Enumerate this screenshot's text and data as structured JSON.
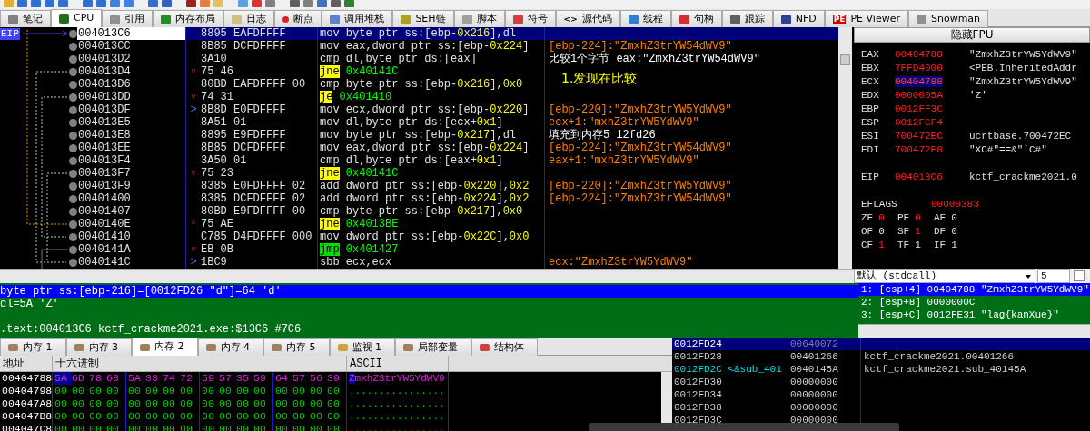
{
  "tabs": [
    {
      "label": "笔记",
      "selected": false
    },
    {
      "label": "CPU",
      "selected": true
    },
    {
      "label": "引用",
      "selected": false
    },
    {
      "label": "内存布局",
      "selected": false
    },
    {
      "label": "日志",
      "selected": false
    },
    {
      "label": "断点",
      "selected": false
    },
    {
      "label": "调用堆栈",
      "selected": false
    },
    {
      "label": "SEH链",
      "selected": false
    },
    {
      "label": "脚本",
      "selected": false
    },
    {
      "label": "符号",
      "selected": false
    },
    {
      "label": "源代码",
      "selected": false,
      "icon_text": "<>"
    },
    {
      "label": "线程",
      "selected": false
    },
    {
      "label": "句柄",
      "selected": false
    },
    {
      "label": "跟踪",
      "selected": false
    },
    {
      "label": "NFD",
      "selected": false
    },
    {
      "label": "PE Viewer",
      "selected": false,
      "icon_text": "PE"
    },
    {
      "label": "Snowman",
      "selected": false
    }
  ],
  "disassembly": {
    "eip_label": "EIP",
    "rows": [
      {
        "address": "004013C6",
        "bytes": "8895 EAFDFFFF",
        "mnemonic": "mov",
        "operands": "byte ptr ss:[ebp-0x216],dl",
        "kind": "plain",
        "selected": true
      },
      {
        "address": "004013CC",
        "bytes": "8B85 DCFDFFFF",
        "mnemonic": "mov",
        "operands": "eax,dword ptr ss:[ebp-0x224]",
        "kind": "plain",
        "selected": false,
        "comment": {
          "text": "[ebp-224]:\"ZmxhZ3trYW54dWV9\"",
          "kind": "auto"
        }
      },
      {
        "address": "004013D2",
        "bytes": "3A10",
        "mnemonic": "cmp",
        "operands": "dl,byte ptr ds:[eax]",
        "kind": "plain",
        "selected": false,
        "comment": {
          "text": "比较1个字节 eax:\"ZmxhZ3trYW54dWV9\"",
          "kind": "user"
        }
      },
      {
        "address": "004013D4",
        "bytes": "75 46",
        "arrow": "v",
        "mnemonic": "jne",
        "operands": "0x40141C",
        "kind": "jcc",
        "selected": false,
        "comment": {
          "text": "1.发现在比较",
          "kind": "note"
        }
      },
      {
        "address": "004013D6",
        "bytes": "80BD EAFDFFFF 00",
        "mnemonic": "cmp",
        "operands": "byte ptr ss:[ebp-0x216],0x0",
        "kind": "plain",
        "selected": false
      },
      {
        "address": "004013DD",
        "bytes": "74 31",
        "arrow": "v",
        "mnemonic": "je",
        "operands": "0x401410",
        "kind": "jcc",
        "selected": false
      },
      {
        "address": "004013DF",
        "bytes": "8B8D E0FDFFFF",
        "arrow": ">",
        "mnemonic": "mov",
        "operands": "ecx,dword ptr ss:[ebp-0x220]",
        "kind": "plain",
        "selected": false,
        "comment": {
          "text": "[ebp-220]:\"ZmxhZ3trYW5YdWV9\"",
          "kind": "auto"
        }
      },
      {
        "address": "004013E5",
        "bytes": "8A51 01",
        "mnemonic": "mov",
        "operands": "dl,byte ptr ds:[ecx+0x1]",
        "kind": "plain",
        "selected": false,
        "comment": {
          "text": "ecx+1:\"mxhZ3trYW5YdWV9\"",
          "kind": "auto"
        }
      },
      {
        "address": "004013E8",
        "bytes": "8895 E9FDFFFF",
        "mnemonic": "mov",
        "operands": "byte ptr ss:[ebp-0x217],dl",
        "kind": "plain",
        "selected": false,
        "comment": {
          "text": "填充到内存5 12fd26",
          "kind": "user"
        }
      },
      {
        "address": "004013EE",
        "bytes": "8B85 DCFDFFFF",
        "mnemonic": "mov",
        "operands": "eax,dword ptr ss:[ebp-0x224]",
        "kind": "plain",
        "selected": false,
        "comment": {
          "text": "[ebp-224]:\"ZmxhZ3trYW54dWV9\"",
          "kind": "auto"
        }
      },
      {
        "address": "004013F4",
        "bytes": "3A50 01",
        "mnemonic": "cmp",
        "operands": "dl,byte ptr ds:[eax+0x1]",
        "kind": "plain",
        "selected": false,
        "comment": {
          "text": "eax+1:\"mxhZ3trYW5YdWV9\"",
          "kind": "auto"
        }
      },
      {
        "address": "004013F7",
        "bytes": "75 23",
        "arrow": "v",
        "mnemonic": "jne",
        "operands": "0x40141C",
        "kind": "jcc",
        "selected": false
      },
      {
        "address": "004013F9",
        "bytes": "8385 E0FDFFFF 02",
        "mnemonic": "add",
        "operands": "dword ptr ss:[ebp-0x220],0x2",
        "kind": "plain",
        "selected": false,
        "comment": {
          "text": "[ebp-220]:\"ZmxhZ3trYW5YdWV9\"",
          "kind": "auto"
        }
      },
      {
        "address": "00401400",
        "bytes": "8385 DCFDFFFF 02",
        "mnemonic": "add",
        "operands": "dword ptr ss:[ebp-0x224],0x2",
        "kind": "plain",
        "selected": false,
        "comment": {
          "text": "[ebp-224]:\"ZmxhZ3trYW54dWV9\"",
          "kind": "auto"
        }
      },
      {
        "address": "00401407",
        "bytes": "80BD E9FDFFFF 00",
        "mnemonic": "cmp",
        "operands": "byte ptr ss:[ebp-0x217],0x0",
        "kind": "plain",
        "selected": false
      },
      {
        "address": "0040140E",
        "bytes": "75 AE",
        "arrow": "^",
        "mnemonic": "jne",
        "operands": "0x4013BE",
        "kind": "jcc",
        "selected": false
      },
      {
        "address": "00401410",
        "bytes": "C785 D4FDFFFF 000",
        "mnemonic": "mov",
        "operands": "dword ptr ss:[ebp-0x22C],0x0",
        "kind": "plain",
        "selected": false
      },
      {
        "address": "0040141A",
        "bytes": "EB 0B",
        "arrow": "v",
        "mnemonic": "jmp",
        "operands": "0x401427",
        "kind": "jmp",
        "selected": false
      },
      {
        "address": "0040141C",
        "bytes": "1BC9",
        "arrow": ">",
        "mnemonic": "sbb",
        "operands": "ecx,ecx",
        "kind": "plain",
        "selected": false,
        "comment": {
          "text": "ecx:\"ZmxhZ3trYW5YdWV9\"",
          "kind": "auto"
        }
      }
    ]
  },
  "registers_panel": {
    "header_button": "隐藏FPU",
    "registers": [
      {
        "name": "EAX",
        "value": "00404788",
        "comment": "\"ZmxhZ3trYW5YdWV9\"",
        "changed": true,
        "selected": false
      },
      {
        "name": "EBX",
        "value": "7FFD4000",
        "comment": "<PEB.InheritedAddr",
        "changed": true,
        "selected": false
      },
      {
        "name": "ECX",
        "value": "00404788",
        "comment": "\"ZmxhZ3trYW5YdWV9\"",
        "changed": true,
        "selected": true
      },
      {
        "name": "EDX",
        "value": "0000005A",
        "comment": "'Z'",
        "changed": true,
        "selected": false
      },
      {
        "name": "EBP",
        "value": "0012FF3C",
        "changed": true,
        "selected": false
      },
      {
        "name": "ESP",
        "value": "0012FCF4",
        "changed": true,
        "selected": false
      },
      {
        "name": "ESI",
        "value": "700472EC",
        "comment": "ucrtbase.700472EC",
        "changed": true,
        "selected": false
      },
      {
        "name": "EDI",
        "value": "700472E8",
        "comment": "\"XC#\"==&\"`C#\"",
        "changed": true,
        "selected": false
      }
    ],
    "eip": {
      "name": "EIP",
      "value": "004013C6",
      "comment": "kctf_crackme2021.0",
      "changed": true
    },
    "eflags": {
      "name": "EFLAGS",
      "value": "00000383",
      "changed": true
    },
    "flags": [
      {
        "name": "ZF",
        "value": "0",
        "changed": true
      },
      {
        "name": "PF",
        "value": "0",
        "changed": true
      },
      {
        "name": "AF",
        "value": "0",
        "changed": false
      },
      {
        "name": "OF",
        "value": "0",
        "changed": false
      },
      {
        "name": "SF",
        "value": "1",
        "changed": true
      },
      {
        "name": "DF",
        "value": "0",
        "changed": false
      },
      {
        "name": "CF",
        "value": "1",
        "changed": true
      },
      {
        "name": "TF",
        "value": "1",
        "changed": false
      },
      {
        "name": "IF",
        "value": "1",
        "changed": false
      }
    ]
  },
  "arguments": {
    "convention": "默认 (stdcall)",
    "count": "5",
    "checked": false,
    "rows": [
      {
        "index": "1:",
        "location": "[esp+4]",
        "value": "00404788",
        "comment": "\"ZmxhZ3trYW5YdWV9\"",
        "selected": true
      },
      {
        "index": "2:",
        "location": "[esp+8]",
        "value": "0000000C",
        "selected": false
      },
      {
        "index": "3:",
        "location": "[esp+C]",
        "value": "0012FE31",
        "comment": "\"lag{kanXue}\"",
        "selected": false
      }
    ]
  },
  "info": {
    "lines": [
      {
        "text": "byte ptr ss:[ebp-216]=[0012FD26 \"d\"]=64 'd'",
        "selected": true
      },
      {
        "text": "dl=5A 'Z'",
        "selected": false
      }
    ],
    "footer": ".text:004013C6 kctf_crackme2021.exe:$13C6 #7C6"
  },
  "memory_tabs": [
    {
      "label": "内存 1",
      "selected": false
    },
    {
      "label": "内存 3",
      "selected": false
    },
    {
      "label": "内存 2",
      "selected": true
    },
    {
      "label": "内存 4",
      "selected": false
    },
    {
      "label": "内存 5",
      "selected": false
    },
    {
      "label": "监视 1",
      "selected": false
    },
    {
      "label": "局部变量",
      "selected": false
    },
    {
      "label": "结构体",
      "selected": false
    }
  ],
  "hex_dump": {
    "columns": [
      "地址",
      "十六进制",
      "ASCII"
    ],
    "rows": [
      {
        "address": "00404788",
        "bytes": [
          "5A",
          "6D",
          "78",
          "68",
          "5A",
          "33",
          "74",
          "72",
          "59",
          "57",
          "35",
          "59",
          "64",
          "57",
          "56",
          "39"
        ],
        "ascii": "ZmxhZ3trYW5YdWV9",
        "highlighted": true,
        "cursor": true
      },
      {
        "address": "00404798",
        "bytes": [
          "00",
          "00",
          "00",
          "00",
          "00",
          "00",
          "00",
          "00",
          "00",
          "00",
          "00",
          "00",
          "00",
          "00",
          "00",
          "00"
        ],
        "ascii": "................",
        "highlighted": false,
        "cursor": false
      },
      {
        "address": "004047A8",
        "bytes": [
          "00",
          "00",
          "00",
          "00",
          "00",
          "00",
          "00",
          "00",
          "00",
          "00",
          "00",
          "00",
          "00",
          "00",
          "00",
          "00"
        ],
        "ascii": "................",
        "highlighted": false,
        "cursor": false
      },
      {
        "address": "004047B8",
        "bytes": [
          "00",
          "00",
          "00",
          "00",
          "00",
          "00",
          "00",
          "00",
          "00",
          "00",
          "00",
          "00",
          "00",
          "00",
          "00",
          "00"
        ],
        "ascii": "................",
        "highlighted": false,
        "cursor": false
      },
      {
        "address": "004047C8",
        "bytes": [
          "00",
          "00",
          "00",
          "00",
          "00",
          "00",
          "00",
          "00",
          "00",
          "00",
          "00",
          "00",
          "00",
          "00",
          "00",
          "00"
        ],
        "ascii": "................",
        "highlighted": false,
        "cursor": false
      }
    ]
  },
  "stack": {
    "rows": [
      {
        "address": "0012FD24",
        "value": "00640072",
        "selected": true
      },
      {
        "address": "0012FD28",
        "value": "00401266",
        "comment": "kctf_crackme2021.00401266",
        "selected": false
      },
      {
        "address": "0012FD2C",
        "label": "<&sub_401",
        "value": "0040145A",
        "comment": "kctf_crackme2021.sub_40145A",
        "selected": false
      },
      {
        "address": "0012FD30",
        "value": "00000000",
        "selected": false
      },
      {
        "address": "0012FD34",
        "value": "00000000",
        "selected": false
      },
      {
        "address": "0012FD38",
        "value": "00000000",
        "selected": false
      },
      {
        "address": "0012FD3C",
        "value": "00000000",
        "selected": false
      }
    ]
  }
}
